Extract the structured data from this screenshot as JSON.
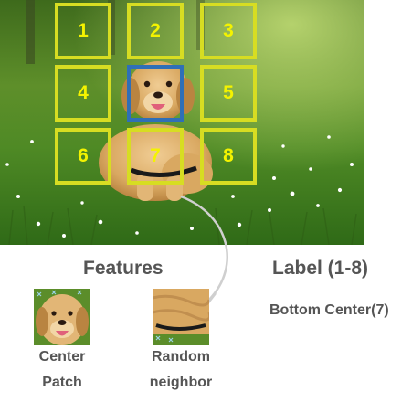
{
  "grid": {
    "cells": [
      {
        "label": "1",
        "row": 0,
        "col": 0
      },
      {
        "label": "2",
        "row": 0,
        "col": 1
      },
      {
        "label": "3",
        "row": 0,
        "col": 2
      },
      {
        "label": "4",
        "row": 1,
        "col": 0
      },
      {
        "label": "",
        "row": 1,
        "col": 1,
        "center": true
      },
      {
        "label": "5",
        "row": 1,
        "col": 2
      },
      {
        "label": "6",
        "row": 2,
        "col": 0
      },
      {
        "label": "7",
        "row": 2,
        "col": 1
      },
      {
        "label": "8",
        "row": 2,
        "col": 2
      }
    ],
    "colors": {
      "grid_border": "#d7dd22",
      "center_border": "#2f6fb7",
      "number_color": "#f4f300"
    }
  },
  "features": {
    "heading": "Features",
    "center_patch_label_line1": "Center",
    "center_patch_label_line2": "Patch",
    "neighbor_patch_label_line1": "Random",
    "neighbor_patch_label_line2": "neighbor"
  },
  "label": {
    "heading": "Label (1-8)",
    "answer": "Bottom Center(7)"
  }
}
